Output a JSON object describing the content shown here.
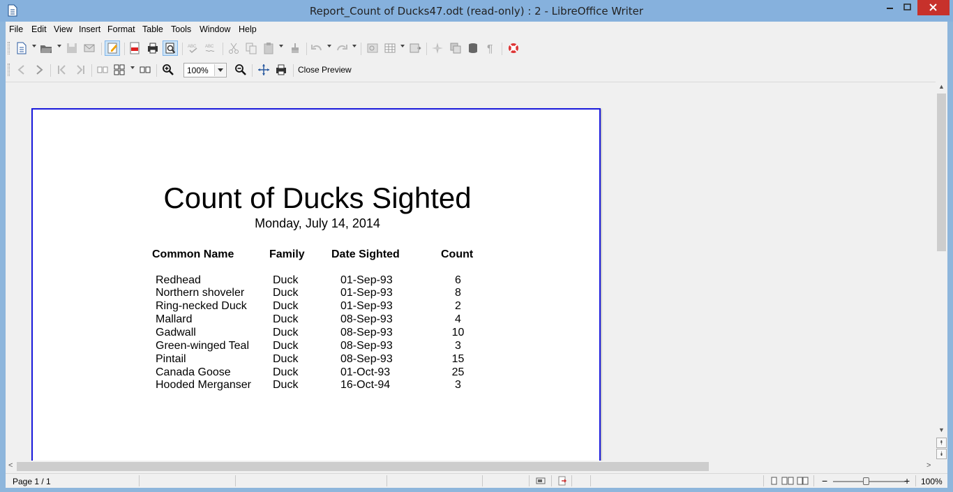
{
  "window": {
    "title": "Report_Count of Ducks47.odt (read-only) : 2 - LibreOffice Writer",
    "controls": {
      "minimize": "–",
      "maximize": "□",
      "close": "✕"
    }
  },
  "menu": [
    "File",
    "Edit",
    "View",
    "Insert",
    "Format",
    "Table",
    "Tools",
    "Window",
    "Help"
  ],
  "toolbar2": {
    "zoom_value": "100%",
    "close_preview_label": "Close Preview"
  },
  "report": {
    "title": "Count of Ducks Sighted",
    "date": "Monday, July 14, 2014",
    "headers": {
      "name": "Common Name",
      "family": "Family",
      "date": "Date Sighted",
      "count": "Count"
    },
    "rows": [
      {
        "name": "Redhead",
        "family": "Duck",
        "date": "01-Sep-93",
        "count": "6"
      },
      {
        "name": "Northern shoveler",
        "family": "Duck",
        "date": "01-Sep-93",
        "count": "8"
      },
      {
        "name": "Ring-necked Duck",
        "family": "Duck",
        "date": "01-Sep-93",
        "count": "2"
      },
      {
        "name": "Mallard",
        "family": "Duck",
        "date": "08-Sep-93",
        "count": "4"
      },
      {
        "name": "Gadwall",
        "family": "Duck",
        "date": "08-Sep-93",
        "count": "10"
      },
      {
        "name": "Green-winged Teal",
        "family": "Duck",
        "date": "08-Sep-93",
        "count": "3"
      },
      {
        "name": "Pintail",
        "family": "Duck",
        "date": "08-Sep-93",
        "count": "15"
      },
      {
        "name": "Canada Goose",
        "family": "Duck",
        "date": "01-Oct-93",
        "count": "25"
      },
      {
        "name": "Hooded Merganser",
        "family": "Duck",
        "date": "16-Oct-94",
        "count": "3"
      }
    ]
  },
  "statusbar": {
    "page_info": "Page 1 / 1",
    "zoom_level": "100%",
    "zoom_out": "−",
    "zoom_in": "+"
  },
  "scroll": {
    "up": "▲",
    "down": "▼",
    "left": "<",
    "right": ">",
    "prev_page": "⯭",
    "next_page": "⯯"
  },
  "colors": {
    "titlebar": "#86b1dd",
    "page_border": "#1a1adc",
    "close_button": "#c7312b"
  }
}
